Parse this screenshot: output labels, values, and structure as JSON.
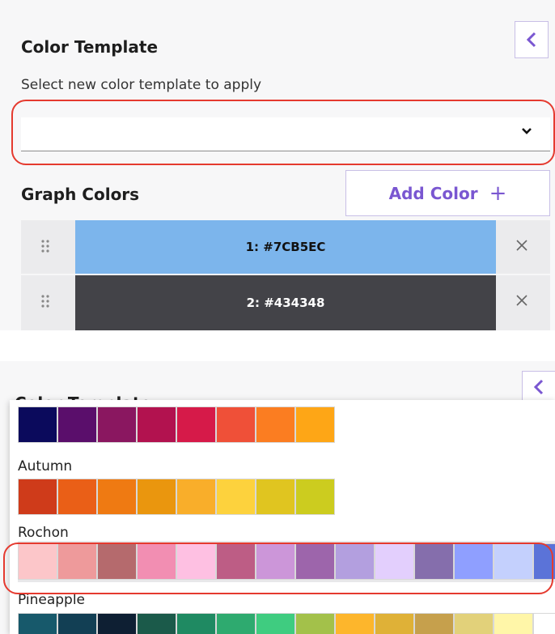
{
  "top": {
    "title": "Color Template",
    "subtitle": "Select new color template to apply",
    "select_value": "",
    "graph_title": "Graph Colors",
    "add_color_label": "Add Color",
    "add_color_icon": "+",
    "colors": [
      {
        "label": "1: #7CB5EC",
        "hex": "#7CB5EC",
        "text_color": "#111111"
      },
      {
        "label": "2: #434348",
        "hex": "#434348",
        "text_color": "#ffffff"
      }
    ]
  },
  "bottom": {
    "title_behind": "Color Template",
    "palettes": [
      {
        "name": "",
        "colors": [
          "#0b0a5c",
          "#5a0e6b",
          "#8a1760",
          "#b2124f",
          "#d61a49",
          "#ef5038",
          "#fb7d21",
          "#fea616"
        ]
      },
      {
        "name": "Autumn",
        "colors": [
          "#cf3b1a",
          "#ea5f17",
          "#ef7a12",
          "#ea960e",
          "#f9ae2a",
          "#fdd23d",
          "#e0c520",
          "#cccc1f"
        ]
      },
      {
        "name": "Rochon",
        "colors": [
          "#fcc6c9",
          "#ee9a9b",
          "#b56a6d",
          "#f28eb2",
          "#fec0e2",
          "#bd5d85",
          "#cc96d9",
          "#9d65ab",
          "#b39fdf",
          "#e3cffd",
          "#856eac",
          "#8f9fff",
          "#c4d0fd",
          "#5b73d8"
        ]
      },
      {
        "name": "Pineapple",
        "colors": [
          "#17596b",
          "#123f54",
          "#0e1f33",
          "#1b5a4a",
          "#1f8a62",
          "#2eaa6f",
          "#3fcc80",
          "#a3c14a",
          "#fdb62c",
          "#dfb137",
          "#c6a04c",
          "#e2d17a",
          "#fff6a8",
          "#ffffff"
        ]
      }
    ]
  },
  "accent": "#7a57d1",
  "highlight": "#e53a2f"
}
